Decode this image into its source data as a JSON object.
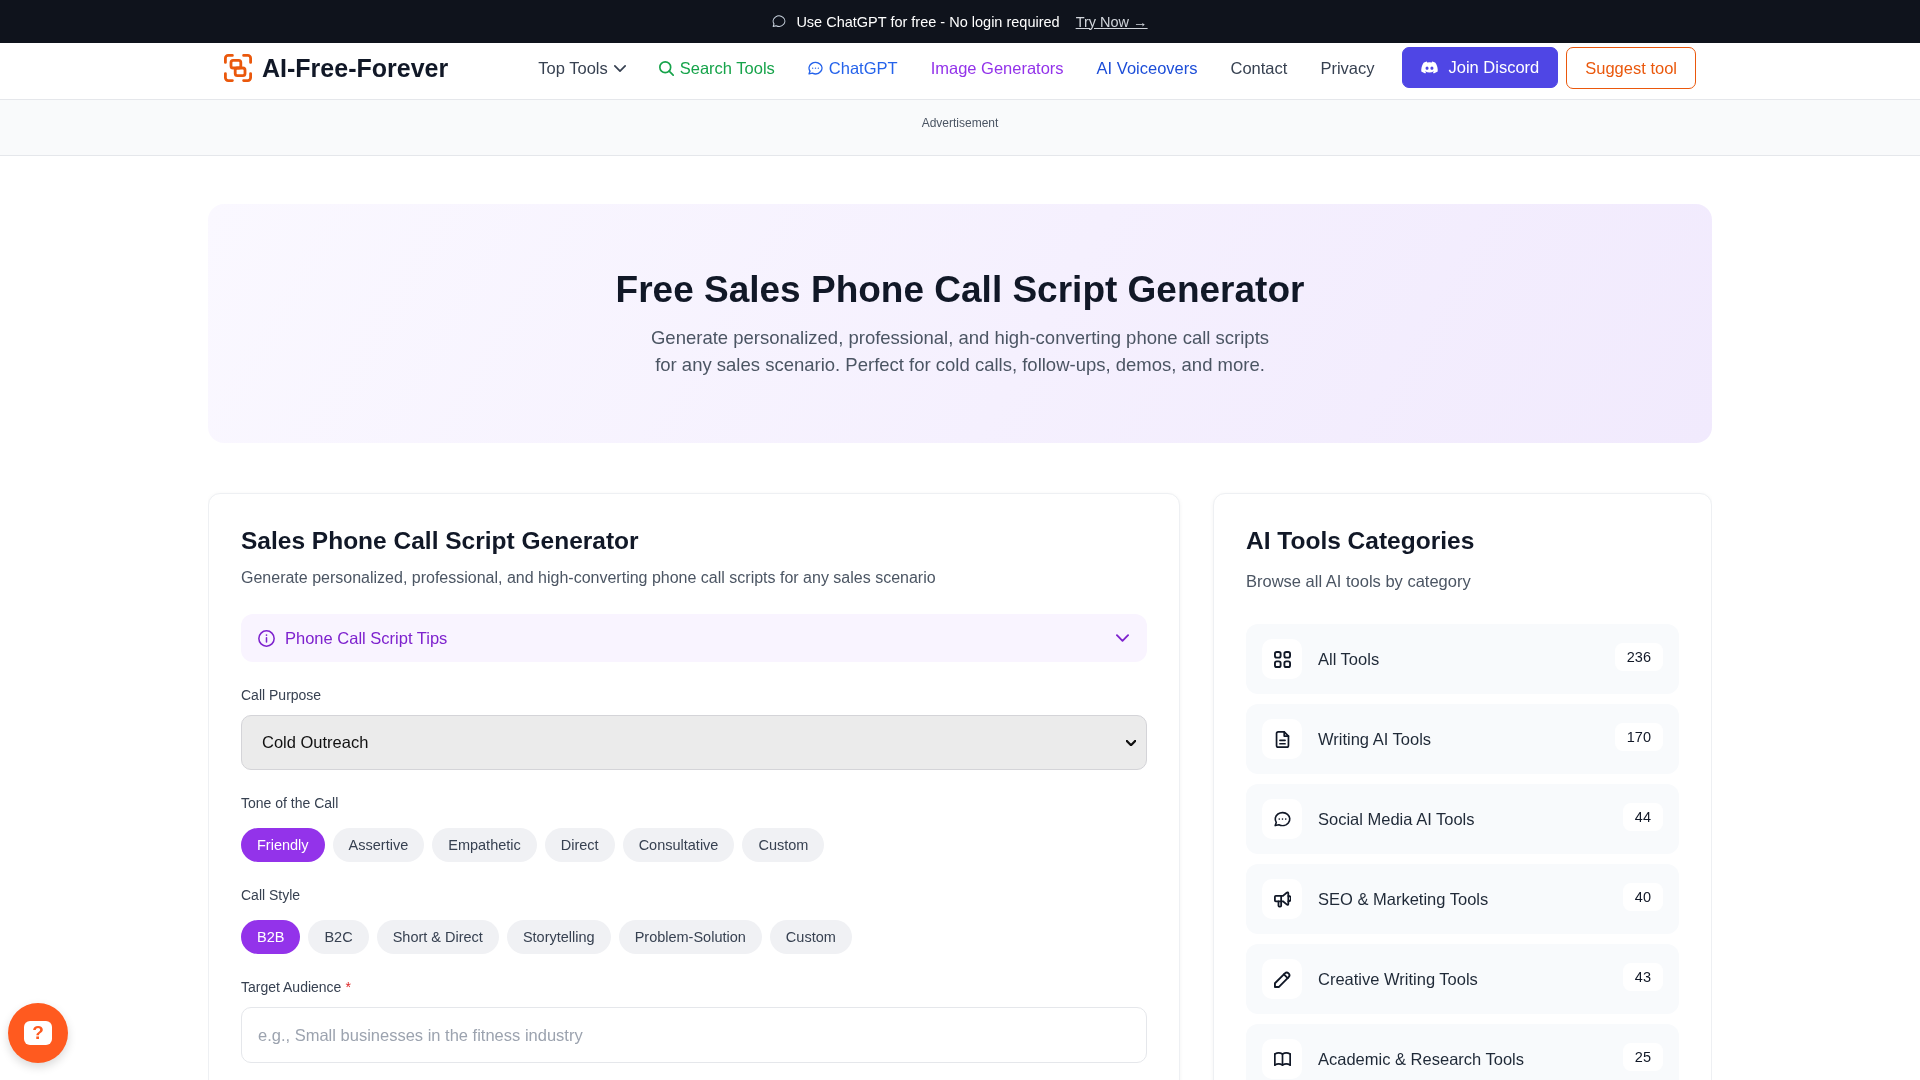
{
  "announcement": {
    "text": "Use ChatGPT for free - No login required",
    "link": "Try Now →"
  },
  "header": {
    "logo": "AI-Free-Forever",
    "nav": [
      {
        "label": "Top Tools",
        "kind": "dropdown",
        "color": "#374151"
      },
      {
        "label": "Search Tools",
        "kind": "search",
        "color": "#16a34a"
      },
      {
        "label": "ChatGPT",
        "kind": "chat",
        "color": "#2563eb"
      },
      {
        "label": "Image Generators",
        "kind": "link",
        "color": "#9333ea"
      },
      {
        "label": "AI Voiceovers",
        "kind": "link",
        "color": "#1d4ed8"
      },
      {
        "label": "Contact",
        "kind": "link",
        "color": "#374151"
      },
      {
        "label": "Privacy",
        "kind": "link",
        "color": "#374151"
      }
    ],
    "buttons": [
      {
        "label": "Join Discord",
        "kind": "primary"
      },
      {
        "label": "Suggest tool",
        "kind": "outline"
      }
    ]
  },
  "ad": {
    "label": "Advertisement"
  },
  "hero": {
    "title": "Free Sales Phone Call Script Generator",
    "subtitle": "Generate personalized, professional, and high-converting phone call scripts for any sales scenario. Perfect for cold calls, follow-ups, demos, and more."
  },
  "generator": {
    "title": "Sales Phone Call Script Generator",
    "subtitle": "Generate personalized, professional, and high-converting phone call scripts for any sales scenario",
    "tips": {
      "label": "Phone Call Script Tips",
      "expanded": false
    },
    "fields": [
      {
        "kind": "select",
        "label": "Call Purpose",
        "value": "Cold Outreach"
      },
      {
        "kind": "options",
        "label": "Tone of the Call",
        "options": [
          {
            "label": "Friendly",
            "selected": true
          },
          {
            "label": "Assertive",
            "selected": false
          },
          {
            "label": "Empathetic",
            "selected": false
          },
          {
            "label": "Direct",
            "selected": false
          },
          {
            "label": "Consultative",
            "selected": false
          },
          {
            "label": "Custom",
            "selected": false
          }
        ]
      },
      {
        "kind": "options",
        "label": "Call Style",
        "options": [
          {
            "label": "B2B",
            "selected": true
          },
          {
            "label": "B2C",
            "selected": false
          },
          {
            "label": "Short & Direct",
            "selected": false
          },
          {
            "label": "Storytelling",
            "selected": false
          },
          {
            "label": "Problem-Solution",
            "selected": false
          },
          {
            "label": "Custom",
            "selected": false
          }
        ]
      },
      {
        "kind": "text",
        "label": "Target Audience",
        "required_mark": "*",
        "placeholder": "e.g., Small businesses in the fitness industry"
      }
    ]
  },
  "categories": {
    "title": "AI Tools Categories",
    "subtitle": "Browse all AI tools by category",
    "items": [
      {
        "label": "All Tools",
        "count": "236"
      },
      {
        "label": "Writing AI Tools",
        "count": "170"
      },
      {
        "label": "Social Media AI Tools",
        "count": "44"
      },
      {
        "label": "SEO & Marketing Tools",
        "count": "40"
      },
      {
        "label": "Creative Writing Tools",
        "count": "43"
      },
      {
        "label": "Academic & Research Tools",
        "count": "25"
      }
    ]
  },
  "help_button": {
    "label": "?"
  }
}
